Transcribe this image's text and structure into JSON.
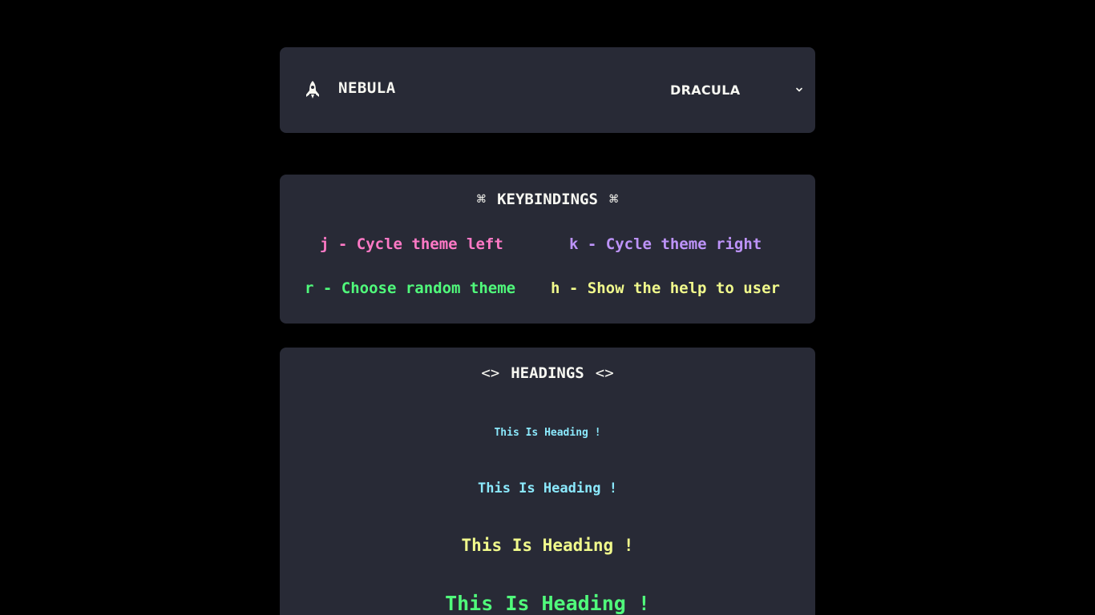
{
  "header": {
    "logo_icon": "rocket-icon",
    "app_title": "NEBULA",
    "theme_select": {
      "value": "DRACULA",
      "icon": "chevron-down-icon"
    }
  },
  "keybindings": {
    "title": "KEYBINDINGS",
    "title_icon": "command-icon",
    "items": [
      {
        "key": "j",
        "text": "j - Cycle theme left",
        "color": "#ff79c6"
      },
      {
        "key": "k",
        "text": "k - Cycle theme right",
        "color": "#bd93f9"
      },
      {
        "key": "r",
        "text": "r - Choose random theme",
        "color": "#50fa7b"
      },
      {
        "key": "h",
        "text": "h - Show the help to user",
        "color": "#f1fa8c"
      }
    ]
  },
  "headings": {
    "title": "HEADINGS",
    "title_icon": "code-icon",
    "items": [
      {
        "level": "h6",
        "text": "This Is Heading !",
        "color": "#8be9fd"
      },
      {
        "level": "h5",
        "text": "This Is Heading !",
        "color": "#8be9fd"
      },
      {
        "level": "h4",
        "text": "This Is Heading !",
        "color": "#f1fa8c"
      },
      {
        "level": "h3",
        "text": "This Is Heading !",
        "color": "#50fa7b"
      }
    ]
  },
  "colors": {
    "background": "#000000",
    "card": "#282a36",
    "foreground": "#f8f8f2"
  }
}
